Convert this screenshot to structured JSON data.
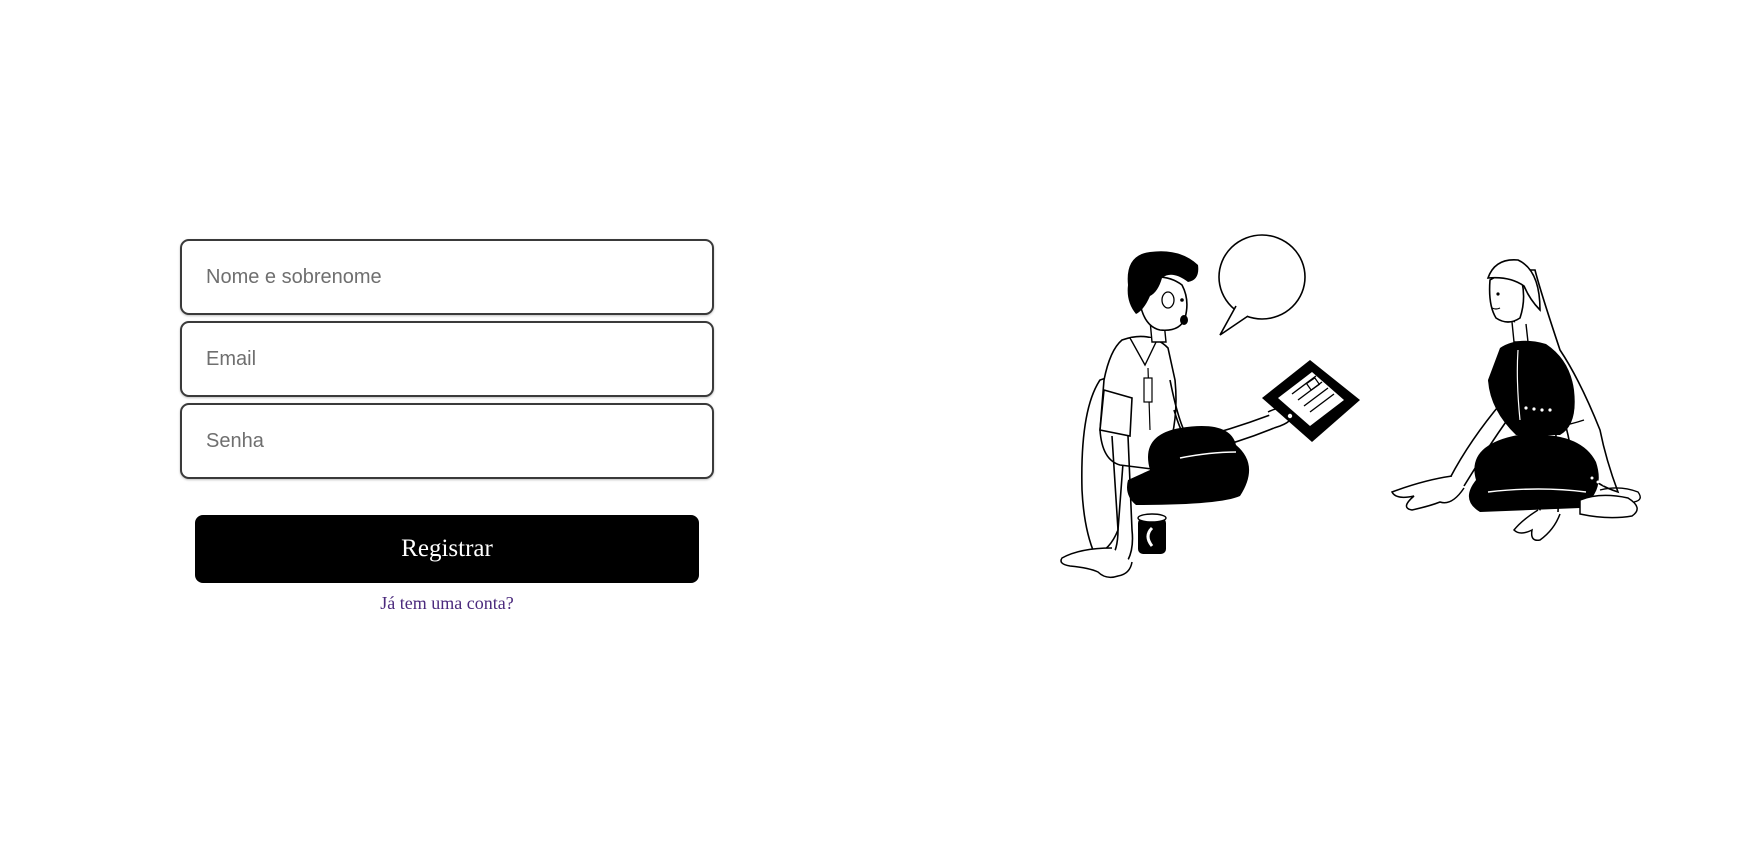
{
  "form": {
    "name_placeholder": "Nome e sobrenome",
    "email_placeholder": "Email",
    "password_placeholder": "Senha",
    "submit_label": "Registrar",
    "login_link": "Já tem uma conta?"
  },
  "illustration": {
    "icon": "two-people-talking-illustration"
  },
  "colors": {
    "button_bg": "#000000",
    "button_text": "#ffffff",
    "link": "#4b2a7d",
    "field_border": "#3a3a3a"
  }
}
